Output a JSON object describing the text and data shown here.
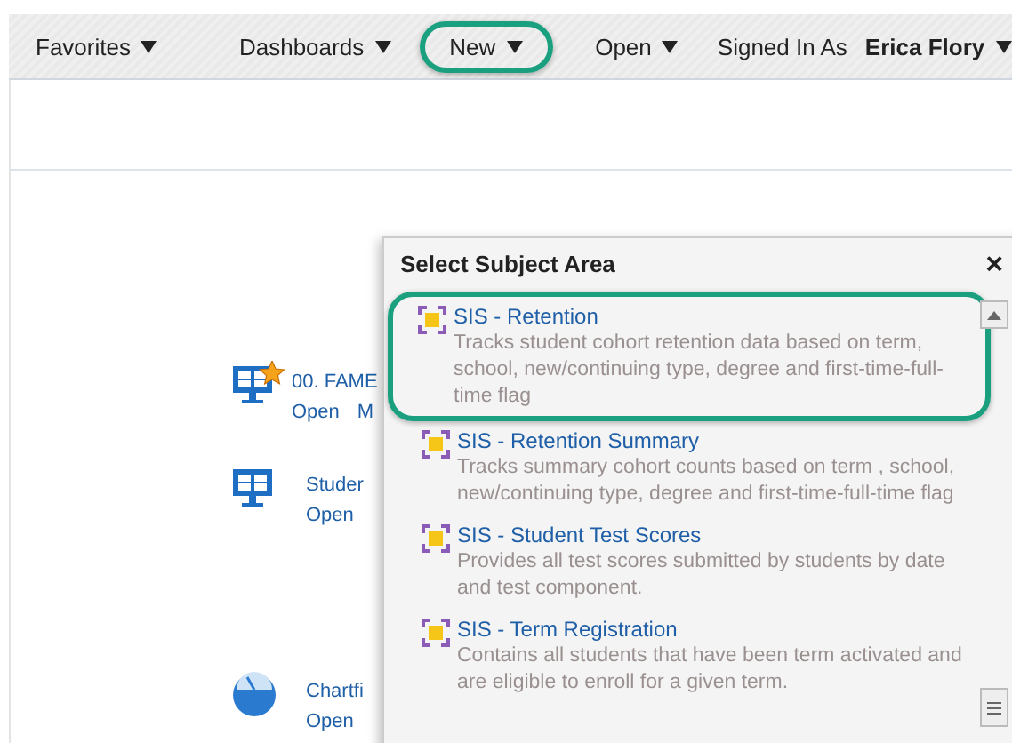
{
  "nav": [
    {
      "label": "Favorites",
      "highlighted": false
    },
    {
      "label": "Dashboards",
      "highlighted": false
    },
    {
      "label": "New",
      "highlighted": true
    },
    {
      "label": "Open",
      "highlighted": false
    }
  ],
  "user": {
    "prefix": "Signed In As",
    "name": "Erica Flory"
  },
  "recent": [
    {
      "kind": "favorite-dashboard",
      "title": "00. FAME",
      "links": [
        "Open",
        "M"
      ]
    },
    {
      "kind": "dashboard",
      "title": "Studer",
      "links": [
        "Open"
      ]
    },
    {
      "kind": "analysis",
      "title": "Chartfi",
      "links": [
        "Open"
      ]
    }
  ],
  "dialog": {
    "title": "Select Subject Area",
    "close": "×",
    "items": [
      {
        "title": "SIS - Retention",
        "description": "Tracks student cohort retention data based on term, school, new/continuing type, degree and first-time-full-time flag",
        "highlighted": true
      },
      {
        "title": "SIS - Retention Summary",
        "description": "Tracks summary cohort counts based on term , school, new/continuing type, degree and first-time-full-time flag",
        "highlighted": false
      },
      {
        "title": "SIS - Student Test Scores",
        "description": "Provides all test scores submitted by students by date and test component.",
        "highlighted": false
      },
      {
        "title": "SIS - Term Registration",
        "description": "Contains all students that have been term activated and are eligible to enroll for a given term.",
        "highlighted": false
      }
    ]
  }
}
